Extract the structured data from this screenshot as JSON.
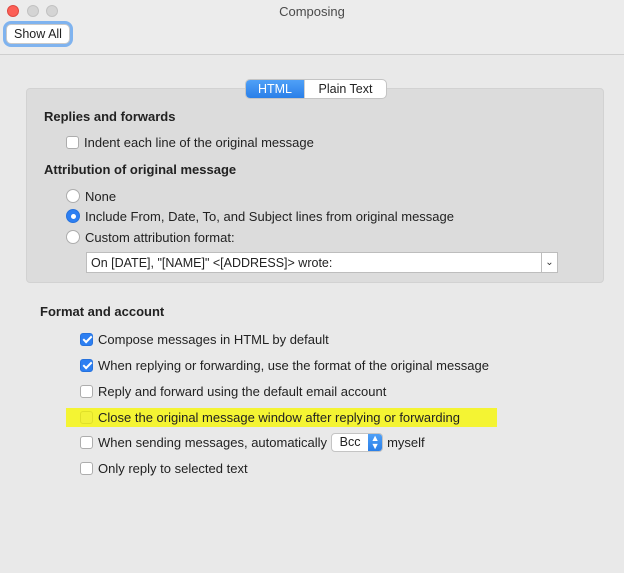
{
  "window": {
    "title": "Composing",
    "show_all_label": "Show All"
  },
  "tabs": [
    {
      "label": "HTML",
      "selected": true
    },
    {
      "label": "Plain Text",
      "selected": false
    }
  ],
  "replies_section": {
    "heading": "Replies and forwards",
    "indent_label": "Indent each line of the original message",
    "indent_checked": false
  },
  "attribution_section": {
    "heading": "Attribution of original message",
    "options": [
      {
        "label": "None",
        "selected": false
      },
      {
        "label": "Include From, Date, To, and Subject lines from original message",
        "selected": true
      },
      {
        "label": "Custom attribution format:",
        "selected": false
      }
    ],
    "custom_format_value": "On [DATE], \"[NAME]\" <[ADDRESS]> wrote:"
  },
  "format_section": {
    "heading": "Format and account",
    "options": [
      {
        "label": "Compose messages in HTML by default",
        "checked": true
      },
      {
        "label": "When replying or forwarding, use the format of the original message",
        "checked": true
      },
      {
        "label": "Reply and forward using the default email account",
        "checked": false
      },
      {
        "label": "Close the original message window after replying or forwarding",
        "checked": false,
        "highlighted": true
      },
      {
        "label": "When sending messages, automatically",
        "checked": false
      },
      {
        "label": "Only reply to selected text",
        "checked": false
      }
    ],
    "bcc_select_value": "Bcc",
    "myself_label": "myself"
  },
  "colors": {
    "accent": "#2d7ff2",
    "highlight": "#f4f433",
    "close_button": "#fc5f56"
  }
}
